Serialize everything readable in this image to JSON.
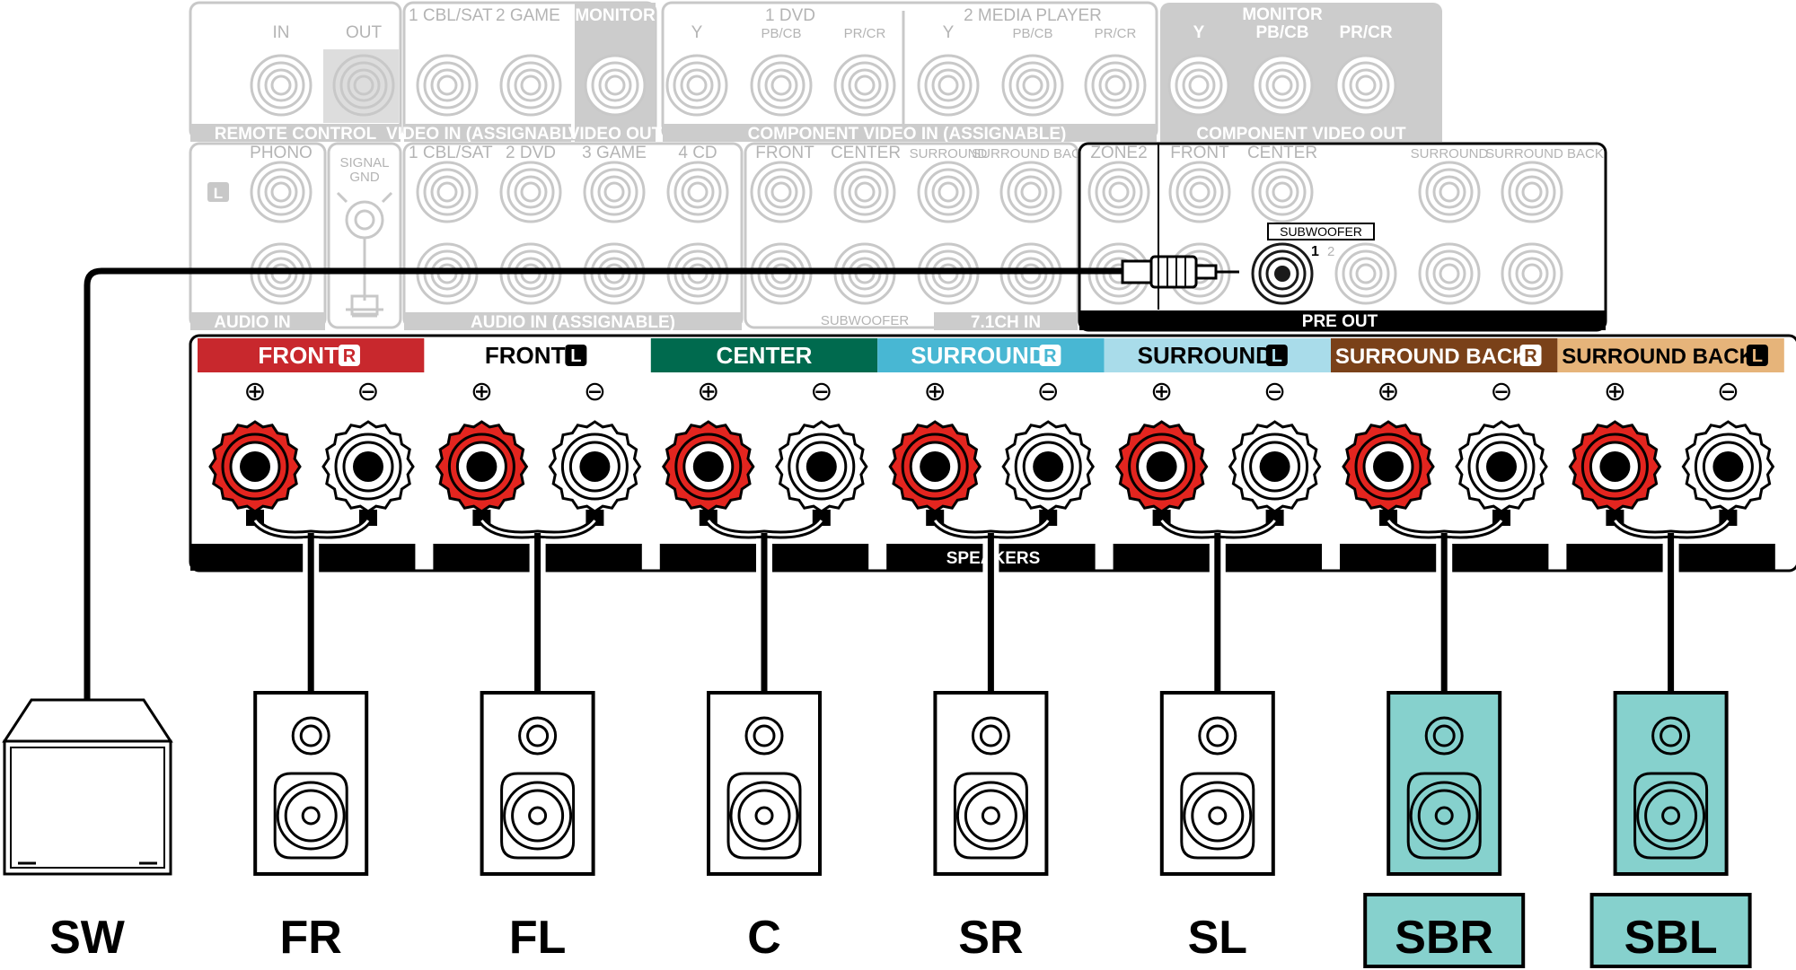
{
  "colors": {
    "front_r": "#c8282d",
    "front_l": "#ffffff",
    "center": "#006a4e",
    "surround_r": "#48b7d3",
    "surround_l": "#a9dcea",
    "surround_back_r": "#7a4119",
    "surround_back_l": "#e6b47a",
    "speaker_highlight": "#86d1cd",
    "terminal_red": "#e3251f",
    "faint_gray": "#c8c8c8"
  },
  "rear_panel": {
    "remote_control": {
      "in": "IN",
      "out": "OUT",
      "label": "REMOTE CONTROL"
    },
    "video_in": {
      "cbl_sat": "1 CBL/SAT",
      "game": "2 GAME",
      "label": "VIDEO IN (ASSIGNABLE)"
    },
    "video_out": {
      "monitor": "MONITOR",
      "label": "VIDEO OUT"
    },
    "component_in": {
      "dvd": "1 DVD",
      "media_player": "2 MEDIA PLAYER",
      "y": "Y",
      "pb": "PB/CB",
      "pr": "PR/CR",
      "label": "COMPONENT VIDEO IN (ASSIGNABLE)"
    },
    "component_out": {
      "monitor": "MONITOR",
      "y": "Y",
      "pb": "PB/CB",
      "pr": "PR/CR",
      "label": "COMPONENT VIDEO OUT"
    },
    "phono": "PHONO",
    "l_badge": "L",
    "signal_gnd": [
      "SIGNAL",
      "GND"
    ],
    "audio_in_label": "AUDIO IN",
    "audio_in_assignable": {
      "cbl_sat": "1 CBL/SAT",
      "dvd": "2 DVD",
      "game": "3 GAME",
      "cd": "4 CD",
      "label": "AUDIO IN (ASSIGNABLE)"
    },
    "ch71_in": {
      "front": "FRONT",
      "center": "CENTER",
      "surround": "SURROUND",
      "surround_back": "SURROUND BACK",
      "subwoofer": "SUBWOOFER",
      "label": "7.1CH IN"
    },
    "zone2": "ZONE2",
    "pre_out": {
      "front": "FRONT",
      "center": "CENTER",
      "surround": "SURROUND",
      "surround_back": "SURROUND BACK",
      "subwoofer": "SUBWOOFER",
      "sub1": "1",
      "sub2": "2",
      "label": "PRE OUT"
    },
    "speakers_label": "SPEAKERS"
  },
  "terminal_groups": [
    {
      "label": "FRONT",
      "badge": "R",
      "color": "#c8282d",
      "text_color": "#ffffff"
    },
    {
      "label": "FRONT",
      "badge": "L",
      "color": "#ffffff",
      "text_color": "#000000"
    },
    {
      "label": "CENTER",
      "badge": "",
      "color": "#006a4e",
      "text_color": "#ffffff"
    },
    {
      "label": "SURROUND",
      "badge": "R",
      "color": "#48b7d3",
      "text_color": "#ffffff"
    },
    {
      "label": "SURROUND",
      "badge": "L",
      "color": "#a9dcea",
      "text_color": "#000000"
    },
    {
      "label": "SURROUND BACK",
      "badge": "R",
      "color": "#7a4119",
      "text_color": "#ffffff"
    },
    {
      "label": "SURROUND BACK",
      "badge": "L",
      "color": "#e6b47a",
      "text_color": "#000000"
    }
  ],
  "polarity": {
    "plus": "⊕",
    "minus": "⊖"
  },
  "speakers": [
    {
      "id": "SW",
      "type": "subwoofer",
      "highlight": false
    },
    {
      "id": "FR",
      "type": "bookshelf",
      "highlight": false
    },
    {
      "id": "FL",
      "type": "bookshelf",
      "highlight": false
    },
    {
      "id": "C",
      "type": "bookshelf",
      "highlight": false
    },
    {
      "id": "SR",
      "type": "bookshelf",
      "highlight": false
    },
    {
      "id": "SL",
      "type": "bookshelf",
      "highlight": false
    },
    {
      "id": "SBR",
      "type": "bookshelf",
      "highlight": true
    },
    {
      "id": "SBL",
      "type": "bookshelf",
      "highlight": true
    }
  ]
}
